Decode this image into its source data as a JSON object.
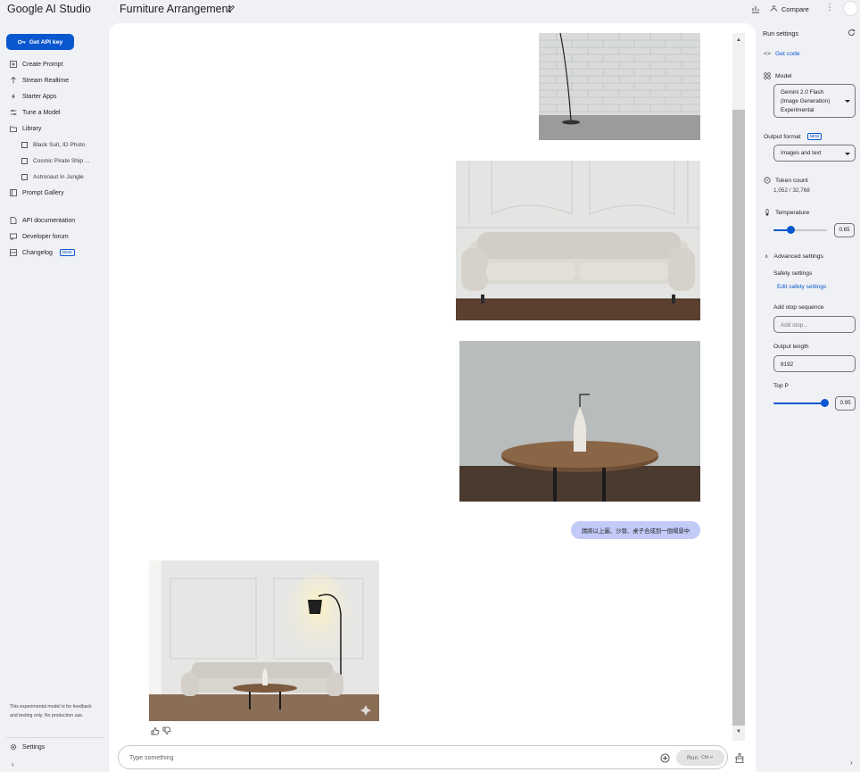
{
  "header": {
    "brand": "Google AI Studio",
    "title": "Furniture Arrangement",
    "compare_label": "Compare"
  },
  "sidebar": {
    "get_api_key_label": "Get API key",
    "items": [
      {
        "label": "Create Prompt",
        "icon": "create-prompt-icon"
      },
      {
        "label": "Stream Realtime",
        "icon": "stream-icon"
      },
      {
        "label": "Starter Apps",
        "icon": "starter-apps-icon"
      },
      {
        "label": "Tune a Model",
        "icon": "tune-icon"
      },
      {
        "label": "Library",
        "icon": "library-icon"
      }
    ],
    "library_items": [
      "Black Suit, ID Photo",
      "Cosmic Pirate Ship ...",
      "Astronaut In Jungle"
    ],
    "gallery_label": "Prompt Gallery",
    "api_docs_label": "API documentation",
    "forum_label": "Developer forum",
    "changelog_label": "Changelog",
    "changelog_badge": "NEW",
    "disclaimer": "This experimental model is for feedback and testing only. No production use.",
    "settings_label": "Settings"
  },
  "chat": {
    "user_message": "請將以上圖、沙發、桌子合成到一個場景中",
    "prompt_placeholder": "Type something",
    "run_label": "Run",
    "run_shortcut": "Ctrl ↵"
  },
  "run_settings": {
    "title": "Run settings",
    "get_code_label": "Get code",
    "model_label": "Model",
    "model_value": "Gemini 2.0 Flash (Image Generation) Experimental",
    "output_format_label": "Output format",
    "output_format_badge": "NEW",
    "output_format_value": "Images and text",
    "token_count_label": "Token count",
    "token_count_value": "1,052 / 32,768",
    "temperature_label": "Temperature",
    "temperature_value": "0.65",
    "temperature_fraction": 0.325,
    "advanced_label": "Advanced settings",
    "safety_label": "Safety settings",
    "edit_safety_label": "Edit safety settings",
    "stop_sequence_label": "Add stop sequence",
    "stop_sequence_placeholder": "Add stop...",
    "output_length_label": "Output length",
    "output_length_value": "8192",
    "top_p_label": "Top P",
    "top_p_value": "0.95",
    "top_p_fraction": 0.95
  },
  "colors": {
    "accent": "#0b57d0",
    "user_bubble": "#c2caf8",
    "background": "#f0f1f5"
  }
}
